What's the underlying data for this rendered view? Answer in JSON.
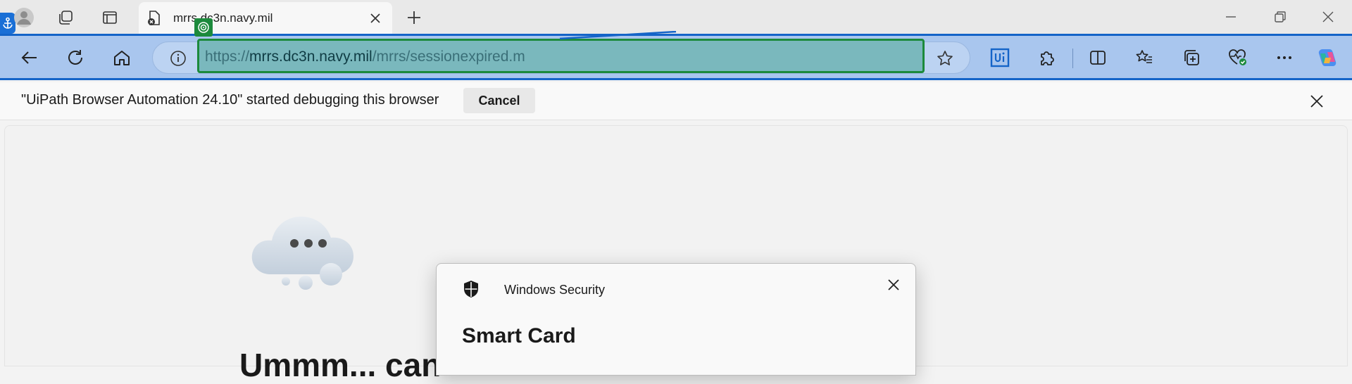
{
  "tab": {
    "title": "mrrs.dc3n.navy.mil"
  },
  "address": {
    "protocol": "https://",
    "host": "mrrs.dc3n.navy.mil",
    "path": "/mrrs/sessionexpired.m"
  },
  "debug_bar": {
    "message": "\"UiPath Browser Automation 24.10\" started debugging this browser",
    "cancel_label": "Cancel"
  },
  "page": {
    "headline": "Ummm... can"
  },
  "dialog": {
    "app_name": "Windows Security",
    "title": "Smart Card"
  },
  "icons": {
    "anchor": "anchor-icon",
    "profile": "profile-icon",
    "workspaces": "workspaces-icon",
    "tab_actions": "tab-actions-icon",
    "favicon": "page-error-icon",
    "new_tab": "plus-icon",
    "back": "back-arrow-icon",
    "refresh": "refresh-icon",
    "home": "home-icon",
    "site_info": "info-icon",
    "favorite": "star-icon",
    "uipath": "uipath-icon",
    "extensions": "puzzle-icon",
    "split": "split-screen-icon",
    "favorites": "favorites-icon",
    "collections": "collections-icon",
    "performance": "heartbeat-icon",
    "more": "more-icon",
    "copilot": "copilot-icon"
  },
  "colors": {
    "toolbar_bg": "#a9c6ee",
    "toolbar_border": "#1464c8",
    "url_highlight": "#7ab8bd",
    "url_highlight_border": "#1c8a3c"
  }
}
